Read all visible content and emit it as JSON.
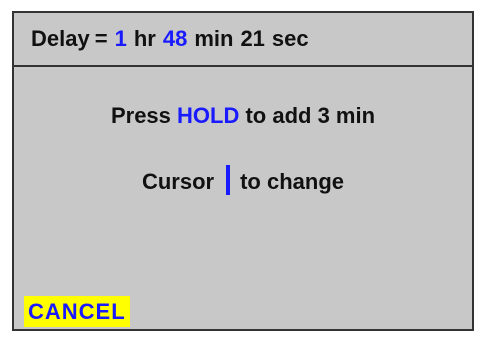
{
  "header": {
    "label": "Delay",
    "equals": "=",
    "hours_value": "1",
    "hours_unit": "hr",
    "minutes_value": "48",
    "minutes_unit": "min",
    "seconds_value": "21",
    "seconds_unit": "sec"
  },
  "instructions": {
    "hold_prefix": "Press",
    "hold_key": "HOLD",
    "hold_suffix": "to add 3 min",
    "cursor_prefix": "Cursor",
    "cursor_suffix": "to change"
  },
  "actions": {
    "cancel_label": "CANCEL"
  },
  "colors": {
    "panel_background": "#c8c8c8",
    "accent_text": "#1a1aff",
    "cancel_background": "#ffff00",
    "border": "#333333"
  }
}
